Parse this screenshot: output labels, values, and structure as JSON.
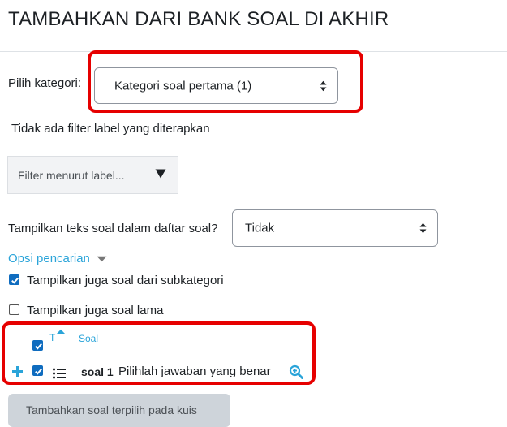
{
  "page": {
    "title": "TAMBAHKAN DARI BANK SOAL DI AKHIR"
  },
  "category": {
    "label": "Pilih kategori:",
    "selected": "Kategori soal pertama (1)"
  },
  "filter": {
    "status_text": "Tidak ada filter label yang diterapkan",
    "placeholder": "Filter menurut label..."
  },
  "show_text": {
    "label": "Tampilkan teks soal dalam daftar soal?",
    "selected": "Tidak"
  },
  "search_options": {
    "label": "Opsi pencarian",
    "subcategories": {
      "label": "Tampilkan juga soal dari subkategori",
      "checked": true
    },
    "old_questions": {
      "label": "Tampilkan juga soal lama",
      "checked": false
    }
  },
  "table": {
    "col_type": "T",
    "col_question": "Soal",
    "rows": [
      {
        "name": "soal 1",
        "text": "Pilihlah jawaban yang benar",
        "checked": true
      }
    ]
  },
  "submit": {
    "label": "Tambahkan soal terpilih pada kuis"
  },
  "colors": {
    "accent": "#2aa4d9",
    "checkbox": "#0f6cbf",
    "highlight": "#e60000"
  }
}
